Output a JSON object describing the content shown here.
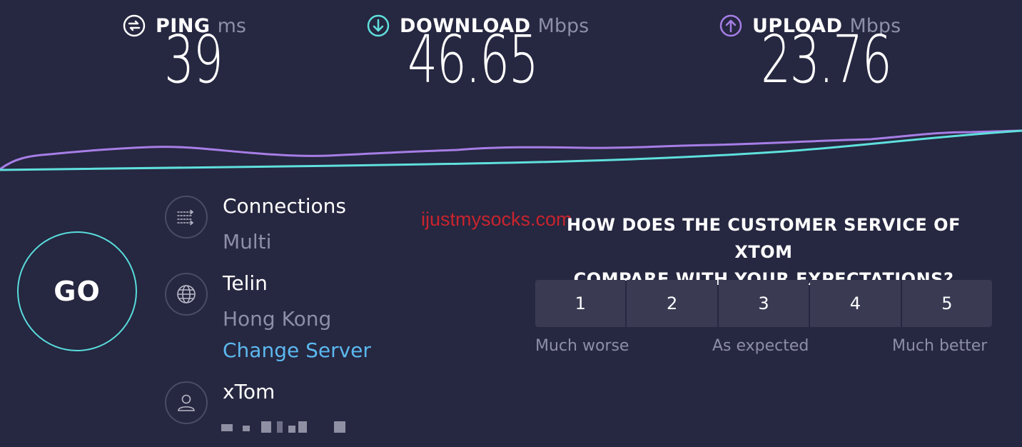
{
  "metrics": {
    "ping": {
      "label": "PING",
      "unit": "ms",
      "value": "39"
    },
    "download": {
      "label": "DOWNLOAD",
      "unit": "Mbps",
      "value": "46.65"
    },
    "upload": {
      "label": "UPLOAD",
      "unit": "Mbps",
      "value": "23.76"
    }
  },
  "colors": {
    "background": "#262740",
    "download_accent": "#5fe0dd",
    "upload_accent": "#a67ee6",
    "go_ring": "#58dcdc",
    "link": "#5cb8ef",
    "watermark": "#d6242c"
  },
  "go_button": {
    "label": "GO"
  },
  "connections": {
    "title": "Connections",
    "value": "Multi",
    "icon": "connections-icon"
  },
  "server": {
    "name": "Telin",
    "location": "Hong Kong",
    "change_label": "Change Server",
    "icon": "globe-icon"
  },
  "provider": {
    "name": "xTom",
    "icon": "user-icon"
  },
  "watermark": "ijustmysocks.com",
  "survey": {
    "question_line1": "HOW DOES THE CUSTOMER SERVICE OF XTOM",
    "question_line2": "COMPARE WITH YOUR EXPECTATIONS?",
    "ratings": [
      "1",
      "2",
      "3",
      "4",
      "5"
    ],
    "scale_low": "Much worse",
    "scale_mid": "As expected",
    "scale_high": "Much better"
  }
}
